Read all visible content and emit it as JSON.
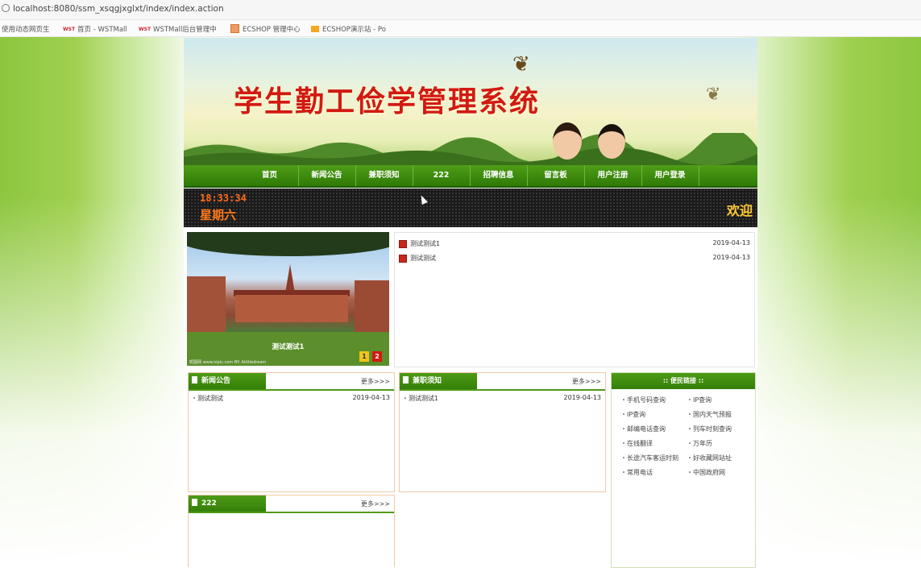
{
  "browser": {
    "url": "localhost:8080/ssm_xsqgjxglxt/index/index.action",
    "bookmarks": [
      {
        "label": "使用动态网页生"
      },
      {
        "label": "首页 - WSTMall"
      },
      {
        "label": "WSTMall后台管理中"
      },
      {
        "label": "ECSHOP 管理中心"
      },
      {
        "label": "ECSHOP演示站 - Po"
      }
    ],
    "wst_badge": "WST"
  },
  "header": {
    "site_title": "学生勤工俭学管理系统"
  },
  "nav": {
    "items": [
      "首页",
      "新闻公告",
      "兼职须知",
      "222",
      "招聘信息",
      "留言板",
      "用户注册",
      "用户登录"
    ]
  },
  "clock": {
    "time": "18:33:34",
    "weekday": "星期六",
    "welcome": "欢迎"
  },
  "slideshow": {
    "caption": "测试测试1",
    "credit": "昵图网 www.nipic.com  BY: Alittledream",
    "pages": [
      "1",
      "2"
    ],
    "colors": {
      "page1": "#f0c419",
      "page2": "#d11a12"
    }
  },
  "news_list": [
    {
      "title": "测试测试1",
      "date": "2019-04-13"
    },
    {
      "title": "测试测试",
      "date": "2019-04-13"
    }
  ],
  "boxes": {
    "news": {
      "title": "新闻公告",
      "more": "更多>>>",
      "rows": [
        {
          "title": "测试测试",
          "date": "2019-04-13"
        }
      ]
    },
    "jobs": {
      "title": "兼职须知",
      "more": "更多>>>",
      "rows": [
        {
          "title": "测试测试1",
          "date": "2019-04-13"
        }
      ]
    },
    "b222": {
      "title": "222",
      "more": "更多>>>"
    }
  },
  "convenience": {
    "title": ":: 便民链接 ::",
    "links": [
      "手机号码查询",
      "IP查询",
      "IP查询",
      "国内天气预报",
      "邮编电话查询",
      "列车时刻查询",
      "在线翻译",
      "万年历",
      "长途汽车客运时刻",
      "好收藏网站址",
      "常用电话",
      "中国政府网"
    ]
  },
  "colors": {
    "nav_green": "#3a8a0b",
    "title_red": "#d11a12",
    "clock_orange": "#ff6a1a",
    "welcome_yellow": "#ffcc33"
  }
}
